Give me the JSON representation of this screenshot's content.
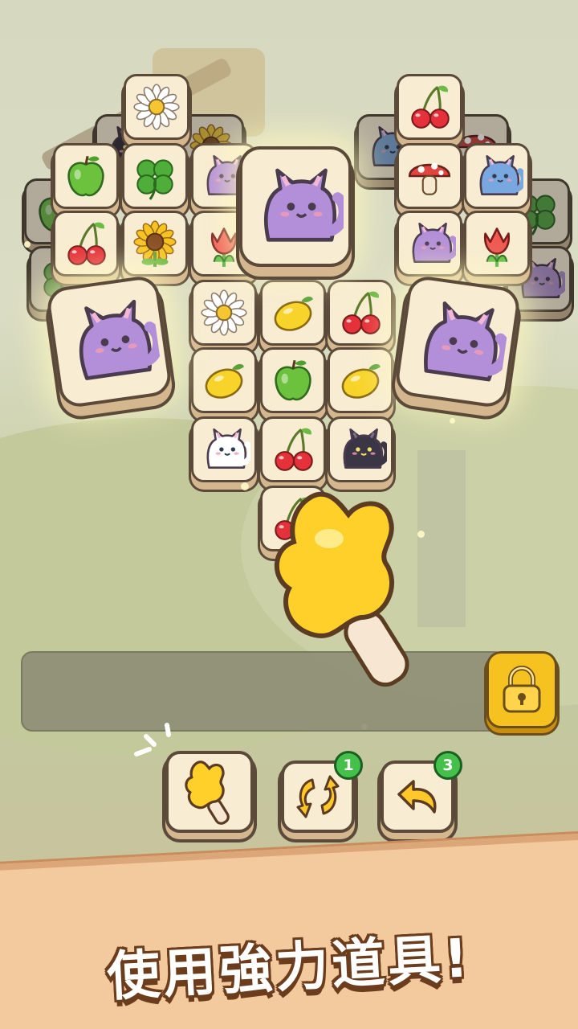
{
  "board": {
    "back_tiles": [
      {
        "icon": "cat-black"
      },
      {
        "icon": "sunflower"
      },
      {
        "icon": "cat-blue"
      },
      {
        "icon": "mushroom"
      },
      {
        "icon": "apple"
      },
      {
        "icon": "clover"
      },
      {
        "icon": "clover"
      },
      {
        "icon": "cat-purple"
      }
    ],
    "tiles": [
      {
        "icon": "daisy"
      },
      {
        "icon": "cherry"
      },
      {
        "icon": "apple"
      },
      {
        "icon": "clover"
      },
      {
        "icon": "cat-purple"
      },
      {
        "icon": "mushroom"
      },
      {
        "icon": "cat-blue"
      },
      {
        "icon": "cherry"
      },
      {
        "icon": "sunflower"
      },
      {
        "icon": "tulip"
      },
      {
        "icon": "cat-purple"
      },
      {
        "icon": "tulip"
      },
      {
        "icon": "daisy"
      },
      {
        "icon": "lemon"
      },
      {
        "icon": "cherry"
      },
      {
        "icon": "lemon"
      },
      {
        "icon": "apple"
      },
      {
        "icon": "lemon"
      },
      {
        "icon": "cat-white"
      },
      {
        "icon": "cherry"
      },
      {
        "icon": "cat-black"
      },
      {
        "icon": "cherry"
      }
    ],
    "highlighted_tiles": [
      {
        "icon": "cat-purple"
      },
      {
        "icon": "cat-purple"
      },
      {
        "icon": "cat-purple"
      }
    ]
  },
  "slot_bar": {
    "lock_icon": "padlock-icon"
  },
  "tools": [
    {
      "name": "popsicle",
      "icon": "popsicle-icon",
      "badge": ""
    },
    {
      "name": "shuffle",
      "icon": "shuffle-icon",
      "badge": "1"
    },
    {
      "name": "undo",
      "icon": "undo-icon",
      "badge": "3"
    }
  ],
  "slogan": "使用強力道具!",
  "colors": {
    "badge": "#45c04a",
    "lock": "#f6c21f",
    "popsicle": "#f8c62c",
    "tile": "#f8ecd2"
  }
}
